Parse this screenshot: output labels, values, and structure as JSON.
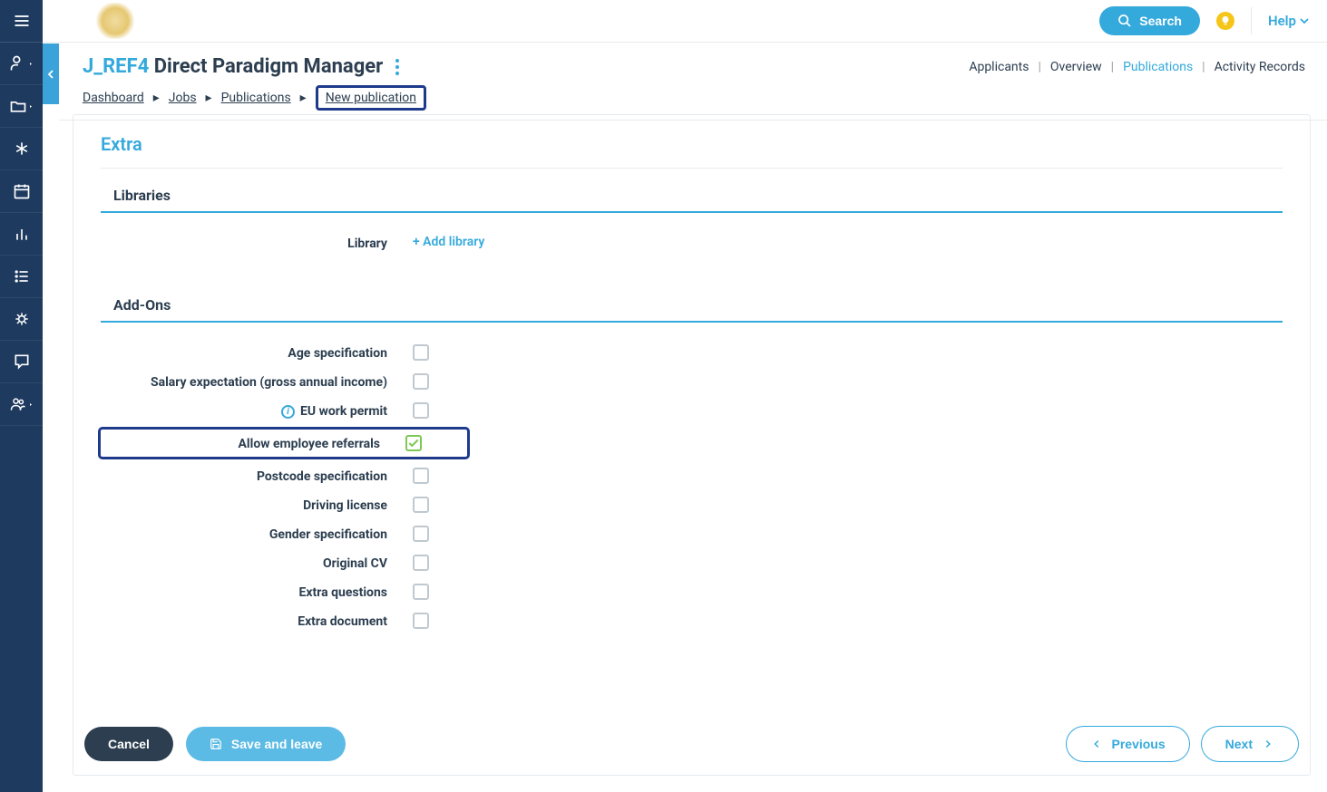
{
  "topbar": {
    "search_label": "Search",
    "help_label": "Help"
  },
  "header": {
    "ref": "J_REF4",
    "title": "Direct Paradigm Manager",
    "tabs": {
      "applicants": "Applicants",
      "overview": "Overview",
      "publications": "Publications",
      "activity": "Activity Records"
    },
    "breadcrumbs": {
      "dashboard": "Dashboard",
      "jobs": "Jobs",
      "publications": "Publications",
      "new_publication": "New publication"
    }
  },
  "content": {
    "section_title": "Extra",
    "libraries": {
      "heading": "Libraries",
      "label": "Library",
      "add_link": "+ Add library"
    },
    "addons": {
      "heading": "Add-Ons",
      "items": {
        "age": "Age specification",
        "salary": "Salary expectation (gross annual income)",
        "eu_permit": "EU work permit",
        "referrals": "Allow employee referrals",
        "postcode": "Postcode specification",
        "driving": "Driving license",
        "gender": "Gender specification",
        "original_cv": "Original CV",
        "extra_questions": "Extra questions",
        "extra_document": "Extra document"
      },
      "checked": {
        "age": false,
        "salary": false,
        "eu_permit": false,
        "referrals": true,
        "postcode": false,
        "driving": false,
        "gender": false,
        "original_cv": false,
        "extra_questions": false,
        "extra_document": false
      }
    }
  },
  "footer": {
    "cancel": "Cancel",
    "save_leave": "Save and leave",
    "previous": "Previous",
    "next": "Next"
  }
}
